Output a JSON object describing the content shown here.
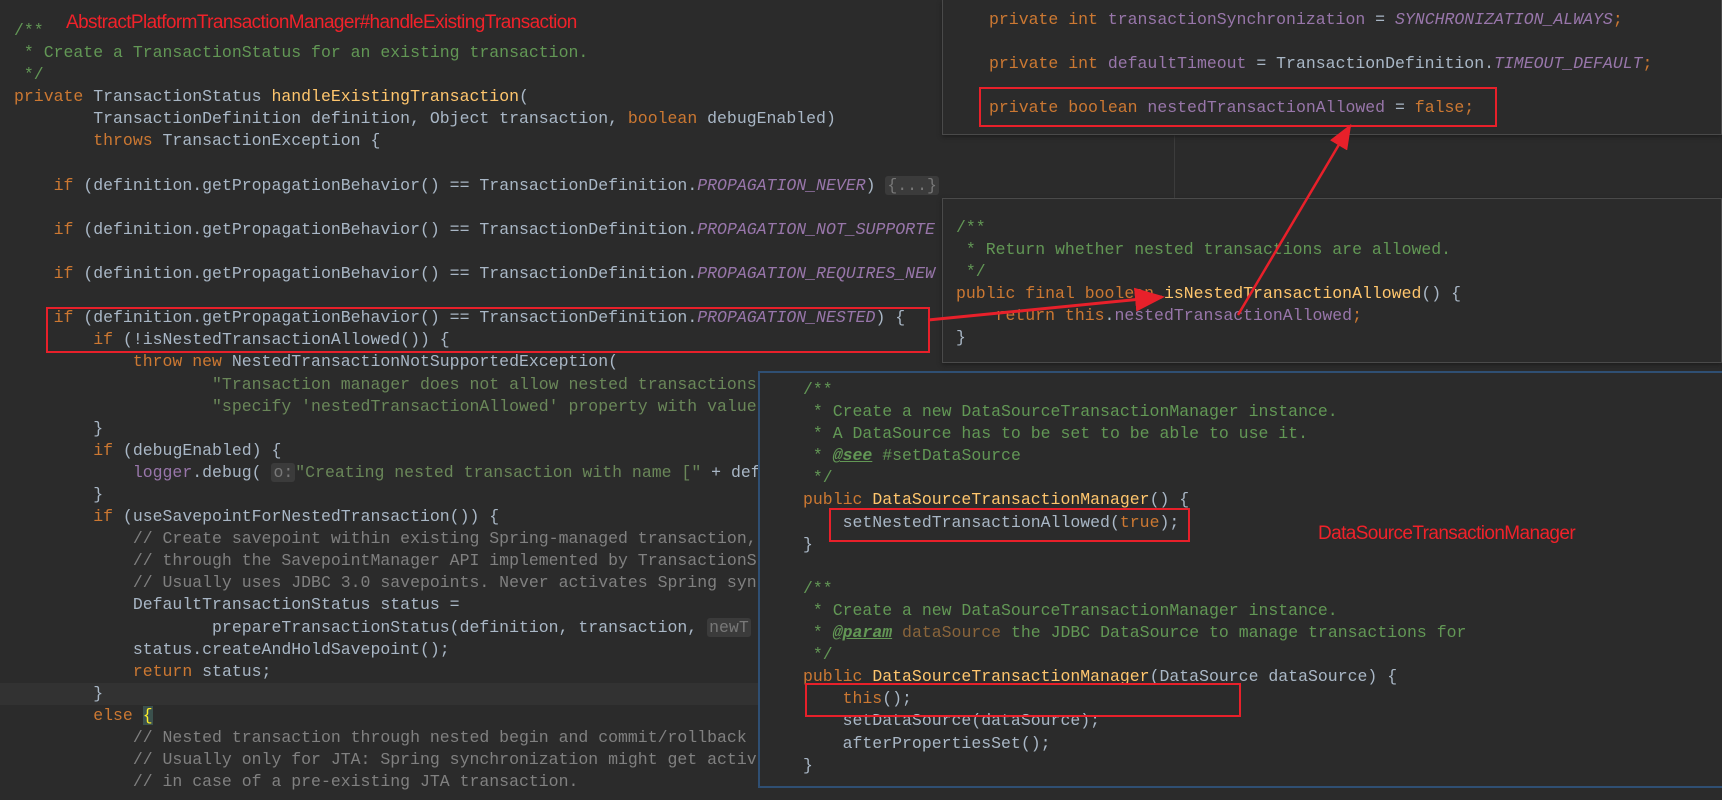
{
  "annotations": {
    "main_title": "AbstractPlatformTransactionManager#handleExistingTransaction",
    "class_label": "DataSourceTransactionManager",
    "highlight_color": "#e8202a"
  },
  "main": {
    "lines": [
      [
        [
          "d",
          "/**"
        ]
      ],
      [
        [
          "d",
          " * Create a TransactionStatus for an existing transaction."
        ]
      ],
      [
        [
          "d",
          " */"
        ]
      ],
      [
        [
          "k",
          "private"
        ],
        [
          "t",
          " TransactionStatus "
        ],
        [
          "m",
          "handleExistingTransaction"
        ],
        [
          "t",
          "("
        ]
      ],
      [
        [
          "t",
          "        TransactionDefinition definition, Object transaction, "
        ],
        [
          "k",
          "boolean"
        ],
        [
          "t",
          " debugEnabled)"
        ]
      ],
      [
        [
          "k",
          "        throws"
        ],
        [
          "t",
          " TransactionException {"
        ]
      ],
      [],
      [
        [
          "k",
          "    if"
        ],
        [
          "t",
          " (definition.getPropagationBehavior() == TransactionDefinition."
        ],
        [
          "fi",
          "PROPAGATION_NEVER"
        ],
        [
          "t",
          ") "
        ],
        [
          "h",
          "{...}"
        ]
      ],
      [],
      [
        [
          "k",
          "    if"
        ],
        [
          "t",
          " (definition.getPropagationBehavior() == TransactionDefinition."
        ],
        [
          "fi",
          "PROPAGATION_NOT_SUPPORTE"
        ]
      ],
      [],
      [
        [
          "k",
          "    if"
        ],
        [
          "t",
          " (definition.getPropagationBehavior() == TransactionDefinition."
        ],
        [
          "fi",
          "PROPAGATION_REQUIRES_NEW"
        ]
      ],
      [],
      [
        [
          "k",
          "    if"
        ],
        [
          "t",
          " (definition.getPropagationBehavior() == TransactionDefinition."
        ],
        [
          "fi",
          "PROPAGATION_NESTED"
        ],
        [
          "t",
          ") {"
        ]
      ],
      [
        [
          "k",
          "        if"
        ],
        [
          "t",
          " (!isNestedTransactionAllowed()) {"
        ]
      ],
      [
        [
          "k",
          "            throw new"
        ],
        [
          "t",
          " NestedTransactionNotSupportedException("
        ]
      ],
      [
        [
          "s",
          "                    \"Transaction manager does not allow nested transactions"
        ]
      ],
      [
        [
          "s",
          "                    \"specify 'nestedTransactionAllowed' property with value"
        ]
      ],
      [
        [
          "t",
          "        }"
        ]
      ],
      [
        [
          "k",
          "        if"
        ],
        [
          "t",
          " (debugEnabled) {"
        ]
      ],
      [
        [
          "f",
          "            logger"
        ],
        [
          "t",
          ".debug( "
        ],
        [
          "h",
          "o:"
        ],
        [
          "s",
          "\"Creating nested transaction with name [\" "
        ],
        [
          "t",
          "+ def"
        ]
      ],
      [
        [
          "t",
          "        }"
        ]
      ],
      [
        [
          "k",
          "        if"
        ],
        [
          "t",
          " (useSavepointForNestedTransaction()) {"
        ]
      ],
      [
        [
          "c",
          "            // Create savepoint within existing Spring-managed transaction,"
        ]
      ],
      [
        [
          "c",
          "            // through the SavepointManager API implemented by TransactionS"
        ]
      ],
      [
        [
          "c",
          "            // Usually uses JDBC 3.0 savepoints. Never activates Spring syn"
        ]
      ],
      [
        [
          "t",
          "            DefaultTransactionStatus status ="
        ]
      ],
      [
        [
          "t",
          "                    prepareTransactionStatus(definition, transaction, "
        ],
        [
          "h",
          "newT"
        ]
      ],
      [
        [
          "t",
          "            status.createAndHoldSavepoint();"
        ]
      ],
      [
        [
          "k",
          "            return"
        ],
        [
          "t",
          " status;"
        ]
      ],
      [
        [
          "t",
          "        }"
        ]
      ],
      [
        [
          "k",
          "        else"
        ],
        [
          "t",
          " "
        ],
        [
          "br",
          "{"
        ]
      ],
      [
        [
          "c",
          "            // Nested transaction through nested begin and commit/rollback"
        ]
      ],
      [
        [
          "c",
          "            // Usually only for JTA: Spring synchronization might get activ"
        ]
      ],
      [
        [
          "c",
          "            // in case of a pre-existing JTA transaction."
        ]
      ]
    ]
  },
  "fields_panel": {
    "lines": [
      [
        [
          "k",
          "private int"
        ],
        [
          "f",
          " transactionSynchronization"
        ],
        [
          "t",
          " = "
        ],
        [
          "fi",
          "SYNCHRONIZATION_ALWAYS"
        ],
        [
          "k",
          ";"
        ]
      ],
      [],
      [
        [
          "k",
          "private int"
        ],
        [
          "f",
          " defaultTimeout"
        ],
        [
          "t",
          " = TransactionDefinition."
        ],
        [
          "fi",
          "TIMEOUT_DEFAULT"
        ],
        [
          "k",
          ";"
        ]
      ],
      [],
      [
        [
          "k",
          "private boolean"
        ],
        [
          "f",
          " nestedTransactionAllowed"
        ],
        [
          "t",
          " = "
        ],
        [
          "k",
          "false;"
        ]
      ]
    ]
  },
  "method_panel": {
    "lines": [
      [
        [
          "d",
          "/**"
        ]
      ],
      [
        [
          "d",
          " * Return whether nested transactions are allowed."
        ]
      ],
      [
        [
          "d",
          " */"
        ]
      ],
      [
        [
          "k",
          "public final boolean "
        ],
        [
          "m",
          "isNestedTransactionAllowed"
        ],
        [
          "t",
          "() {"
        ]
      ],
      [
        [
          "k",
          "    return this"
        ],
        [
          "t",
          "."
        ],
        [
          "f",
          "nestedTransactionAllowed"
        ],
        [
          "k",
          ";"
        ]
      ],
      [
        [
          "t",
          "}"
        ]
      ]
    ]
  },
  "ctor_panel": {
    "lines": [
      [
        [
          "d",
          "/**"
        ]
      ],
      [
        [
          "d",
          " * Create a new DataSourceTransactionManager instance."
        ]
      ],
      [
        [
          "d",
          " * A DataSource has to be set to be able to use it."
        ]
      ],
      [
        [
          "d",
          " * "
        ],
        [
          "dt",
          "@see"
        ],
        [
          "d",
          " #setDataSource"
        ]
      ],
      [
        [
          "d",
          " */"
        ]
      ],
      [
        [
          "k",
          "public "
        ],
        [
          "m",
          "DataSourceTransactionManager"
        ],
        [
          "t",
          "() {"
        ]
      ],
      [
        [
          "t",
          "    setNestedTransactionAllowed("
        ],
        [
          "k",
          "true"
        ],
        [
          "t",
          ");"
        ]
      ],
      [
        [
          "t",
          "}"
        ]
      ],
      [],
      [
        [
          "d",
          "/**"
        ]
      ],
      [
        [
          "d",
          " * Create a new DataSourceTransactionManager instance."
        ]
      ],
      [
        [
          "d",
          " * "
        ],
        [
          "dt",
          "@param"
        ],
        [
          "dp",
          " dataSource"
        ],
        [
          "d",
          " the JDBC DataSource to manage transactions for"
        ]
      ],
      [
        [
          "d",
          " */"
        ]
      ],
      [
        [
          "k",
          "public "
        ],
        [
          "m",
          "DataSourceTransactionManager"
        ],
        [
          "t",
          "(DataSource dataSource) {"
        ]
      ],
      [
        [
          "k",
          "    this"
        ],
        [
          "t",
          "();"
        ]
      ],
      [
        [
          "t",
          "    setDataSource(dataSource);"
        ]
      ],
      [
        [
          "t",
          "    afterPropertiesSet();"
        ]
      ],
      [
        [
          "t",
          "}"
        ]
      ]
    ]
  }
}
